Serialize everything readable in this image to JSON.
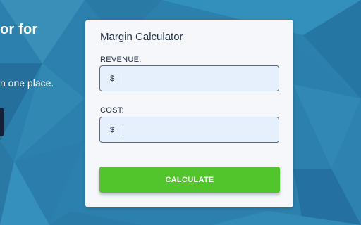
{
  "hero": {
    "title_fragment": "or for",
    "subtitle_fragment": "n one place."
  },
  "calculator": {
    "title": "Margin Calculator",
    "revenue": {
      "label": "REVENUE:",
      "prefix": "$",
      "value": ""
    },
    "cost": {
      "label": "COST:",
      "prefix": "$",
      "value": ""
    },
    "button_label": "CALCULATE"
  },
  "colors": {
    "background": "#2c80ad",
    "button": "#52c52c",
    "input_fill": "#e6f0fd",
    "hero_button": "#12213a"
  }
}
